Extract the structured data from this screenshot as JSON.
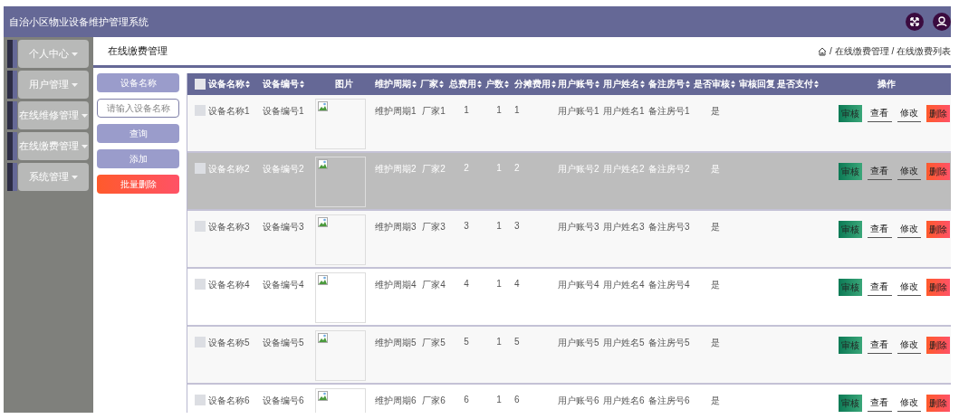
{
  "header": {
    "title": "自治小区物业设备维护管理系统"
  },
  "sidebar": {
    "items": [
      {
        "label": "个人中心"
      },
      {
        "label": "用户管理"
      },
      {
        "label": "在线维修管理"
      },
      {
        "label": "在线缴费管理"
      },
      {
        "label": "系统管理"
      }
    ]
  },
  "page": {
    "title": "在线缴费管理",
    "breadcrumb": "/ 在线缴费管理 / 在线缴费列表"
  },
  "tools": {
    "label": "设备名称",
    "search": {
      "placeholder": "请输入设备名称"
    },
    "buttons": [
      {
        "label": "查询",
        "kind": "plain"
      },
      {
        "label": "添加",
        "kind": "plain"
      },
      {
        "label": "批量删除",
        "kind": "danger"
      }
    ]
  },
  "table": {
    "select_all": {
      "checked": false
    },
    "columns": [
      {
        "label": "设备名称",
        "sortable": true
      },
      {
        "label": "设备编号",
        "sortable": true
      },
      {
        "label": "图片",
        "sortable": false
      },
      {
        "label": "维护周期",
        "sortable": true
      },
      {
        "label": "厂家",
        "sortable": true
      },
      {
        "label": "总费用",
        "sortable": true
      },
      {
        "label": "户数",
        "sortable": true
      },
      {
        "label": "分摊费用",
        "sortable": true
      },
      {
        "label": "用户账号",
        "sortable": true
      },
      {
        "label": "用户姓名",
        "sortable": true
      },
      {
        "label": "备注房号",
        "sortable": true
      },
      {
        "label": "是否审核",
        "sortable": true
      },
      {
        "label": "审核回复",
        "sortable": false
      },
      {
        "label": "是否支付",
        "sortable": true
      },
      {
        "label": "操作",
        "sortable": false
      }
    ],
    "rows": [
      {
        "checked": false,
        "highlighted": false,
        "cells": [
          "设备名称1",
          "设备编号1",
          null,
          "维护周期1",
          "厂家1",
          "1",
          "1",
          "1",
          "用户账号1",
          "用户姓名1",
          "备注房号1",
          "是",
          null,
          null
        ],
        "actions": [
          {
            "label": "审核",
            "kind": "approve"
          },
          {
            "label": "查看",
            "kind": "link"
          },
          {
            "label": "修改",
            "kind": "link"
          },
          {
            "label": "删除",
            "kind": "delete"
          }
        ]
      },
      {
        "checked": false,
        "highlighted": true,
        "cells": [
          "设备名称2",
          "设备编号2",
          null,
          "维护周期2",
          "厂家2",
          "2",
          "1",
          "2",
          "用户账号2",
          "用户姓名2",
          "备注房号2",
          "是",
          null,
          null
        ],
        "actions": [
          {
            "label": "审核",
            "kind": "approve"
          },
          {
            "label": "查看",
            "kind": "link"
          },
          {
            "label": "修改",
            "kind": "link"
          },
          {
            "label": "删除",
            "kind": "delete"
          }
        ]
      },
      {
        "checked": false,
        "highlighted": false,
        "cells": [
          "设备名称3",
          "设备编号3",
          null,
          "维护周期3",
          "厂家3",
          "3",
          "1",
          "3",
          "用户账号3",
          "用户姓名3",
          "备注房号3",
          "是",
          null,
          null
        ],
        "actions": [
          {
            "label": "审核",
            "kind": "approve"
          },
          {
            "label": "查看",
            "kind": "link"
          },
          {
            "label": "修改",
            "kind": "link"
          },
          {
            "label": "删除",
            "kind": "delete"
          }
        ]
      },
      {
        "checked": false,
        "highlighted": false,
        "cells": [
          "设备名称4",
          "设备编号4",
          null,
          "维护周期4",
          "厂家4",
          "4",
          "1",
          "4",
          "用户账号4",
          "用户姓名4",
          "备注房号4",
          "是",
          null,
          null
        ],
        "actions": [
          {
            "label": "审核",
            "kind": "approve"
          },
          {
            "label": "查看",
            "kind": "link"
          },
          {
            "label": "修改",
            "kind": "link"
          },
          {
            "label": "删除",
            "kind": "delete"
          }
        ]
      },
      {
        "checked": false,
        "highlighted": false,
        "cells": [
          "设备名称5",
          "设备编号5",
          null,
          "维护周期5",
          "厂家5",
          "5",
          "1",
          "5",
          "用户账号5",
          "用户姓名5",
          "备注房号5",
          "是",
          null,
          null
        ],
        "actions": [
          {
            "label": "审核",
            "kind": "approve"
          },
          {
            "label": "查看",
            "kind": "link"
          },
          {
            "label": "修改",
            "kind": "link"
          },
          {
            "label": "删除",
            "kind": "delete"
          }
        ]
      },
      {
        "checked": false,
        "highlighted": false,
        "cells": [
          "设备名称6",
          "设备编号6",
          null,
          "维护周期6",
          "厂家6",
          "6",
          "1",
          "6",
          "用户账号6",
          "用户姓名6",
          "备注房号6",
          "是",
          null,
          null
        ],
        "actions": [
          {
            "label": "审核",
            "kind": "approve"
          },
          {
            "label": "查看",
            "kind": "link"
          },
          {
            "label": "修改",
            "kind": "link"
          },
          {
            "label": "删除",
            "kind": "delete"
          }
        ]
      }
    ]
  }
}
